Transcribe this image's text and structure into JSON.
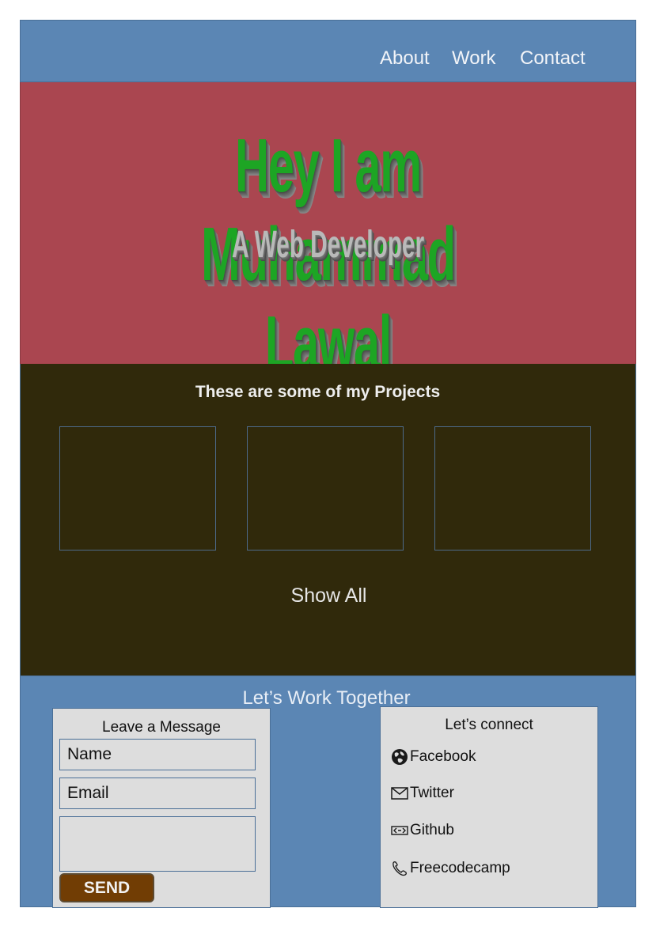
{
  "nav": {
    "about": "About",
    "work": "Work",
    "contact": "Contact"
  },
  "hero": {
    "title": "Hey I am Muhammad Lawal",
    "subtitle": "A Web Developer"
  },
  "projects": {
    "heading": "These are some of my Projects",
    "show_all": "Show All"
  },
  "contact": {
    "heading": "Let’s Work Together",
    "message": {
      "label": "Leave a Message",
      "name_placeholder": "Name",
      "email_placeholder": "Email",
      "message_placeholder": "",
      "send_label": "SEND"
    },
    "connect": {
      "label": "Let’s connect",
      "links": [
        {
          "label": "Facebook",
          "icon": "globe-icon"
        },
        {
          "label": "Twitter",
          "icon": "envelope-icon"
        },
        {
          "label": "Github",
          "icon": "code-icon"
        },
        {
          "label": "Freecodecamp",
          "icon": "phone-icon"
        }
      ]
    }
  },
  "colors": {
    "header": "#5b86b4",
    "hero": "#aa4650",
    "projects": "#30290b",
    "title_green": "#1da524",
    "send_button": "#713d04"
  }
}
